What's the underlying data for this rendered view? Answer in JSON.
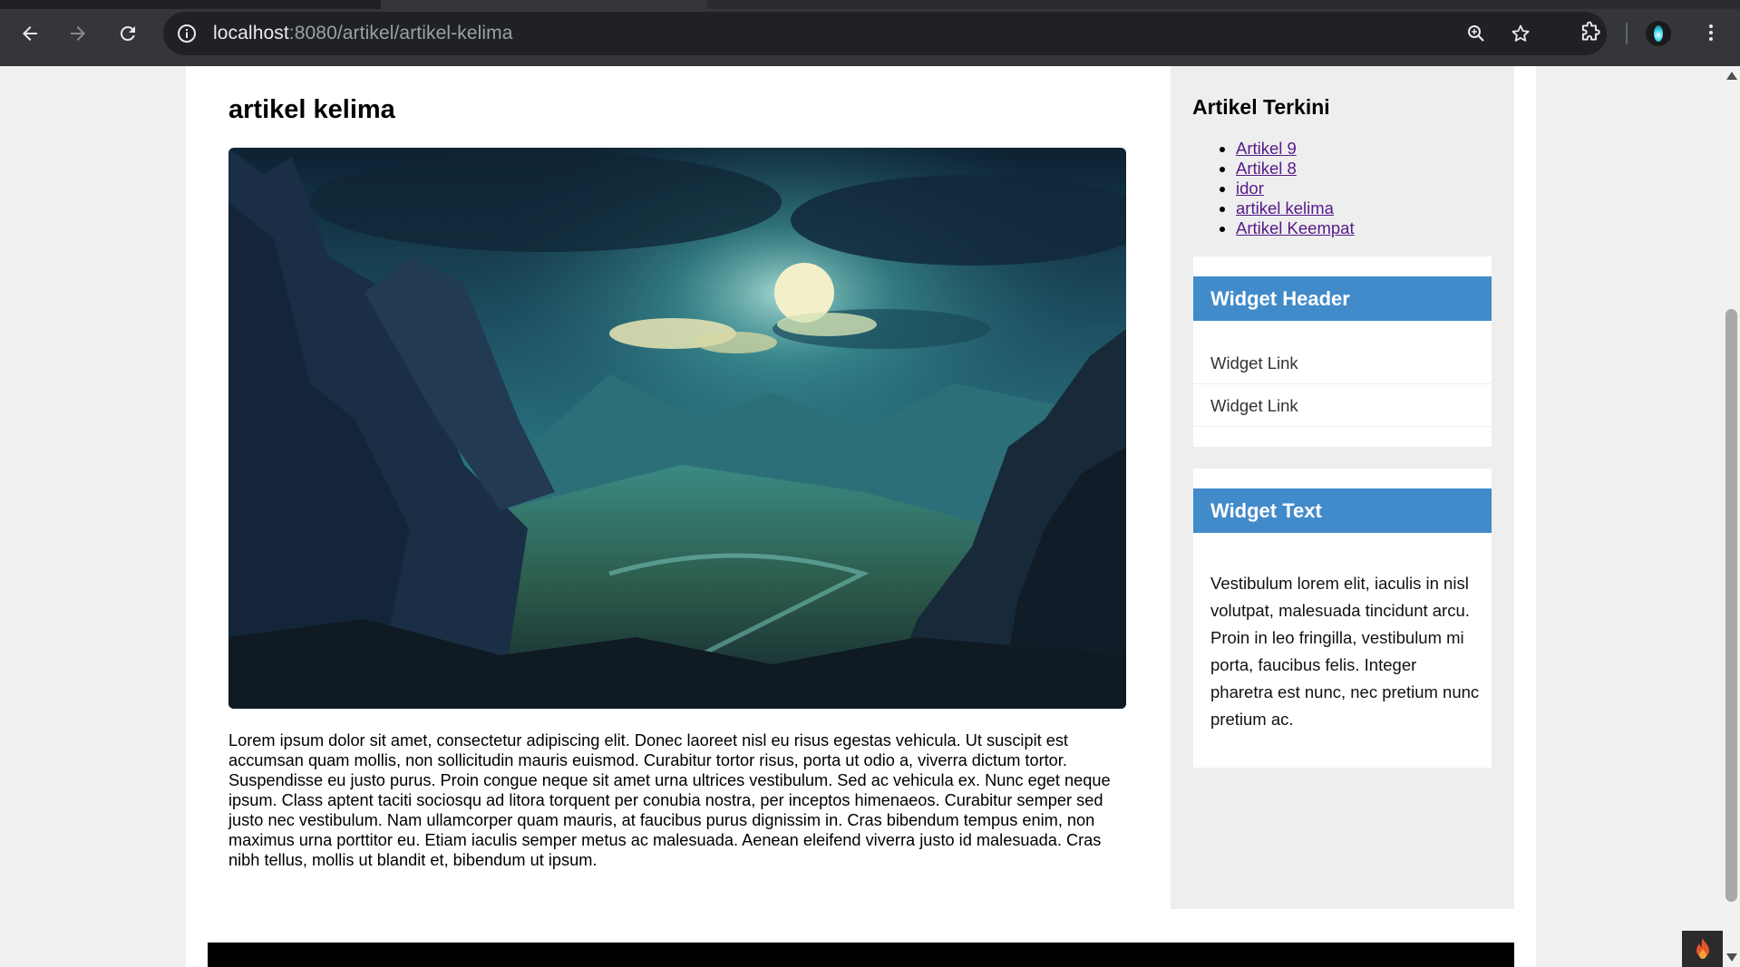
{
  "browser": {
    "url_host": "localhost",
    "url_rest": ":8080/artikel/artikel-kelima",
    "icons": [
      "back-icon",
      "forward-icon",
      "reload-icon",
      "info-icon",
      "zoom-icon",
      "bookmark-star-icon",
      "extensions-icon",
      "profile-avatar",
      "menu-icon"
    ]
  },
  "article": {
    "title": "artikel kelima",
    "image_alt": "Moonlit mountain valley landscape",
    "body": "Lorem ipsum dolor sit amet, consectetur adipiscing elit. Donec laoreet nisl eu risus egestas vehicula. Ut suscipit est accumsan quam mollis, non sollicitudin mauris euismod. Curabitur tortor risus, porta ut odio a, viverra dictum tortor. Suspendisse eu justo purus. Proin congue neque sit amet urna ultrices vestibulum. Sed ac vehicula ex. Nunc eget neque ipsum. Class aptent taciti sociosqu ad litora torquent per conubia nostra, per inceptos himenaeos. Curabitur semper sed justo nec vestibulum. Nam ullamcorper quam mauris, at faucibus purus dignissim in. Cras bibendum tempus enim, non maximus urna porttitor eu. Etiam iaculis semper metus ac malesuada. Aenean eleifend viverra justo id malesuada. Cras nibh tellus, mollis ut blandit et, bibendum ut ipsum."
  },
  "sidebar": {
    "title": "Artikel Terkini",
    "recent": [
      "Artikel 9",
      "Artikel 8",
      "idor",
      "artikel kelima",
      "Artikel Keempat"
    ],
    "widget_links": {
      "header": "Widget Header",
      "links": [
        "Widget Link",
        "Widget Link"
      ]
    },
    "widget_text": {
      "header": "Widget Text",
      "text": "Vestibulum lorem elit, iaculis in nisl volutpat, malesuada tincidunt arcu. Proin in leo fringilla, vestibulum mi porta, faucibus felis. Integer pharetra est nunc, nec pretium nunc pretium ac."
    }
  },
  "colors": {
    "chrome_bg": "#35363a",
    "omnibox_bg": "#202124",
    "widget_header_bg": "#428bca",
    "link_visited": "#551a8b",
    "sidebar_bg": "#eeeeee"
  }
}
